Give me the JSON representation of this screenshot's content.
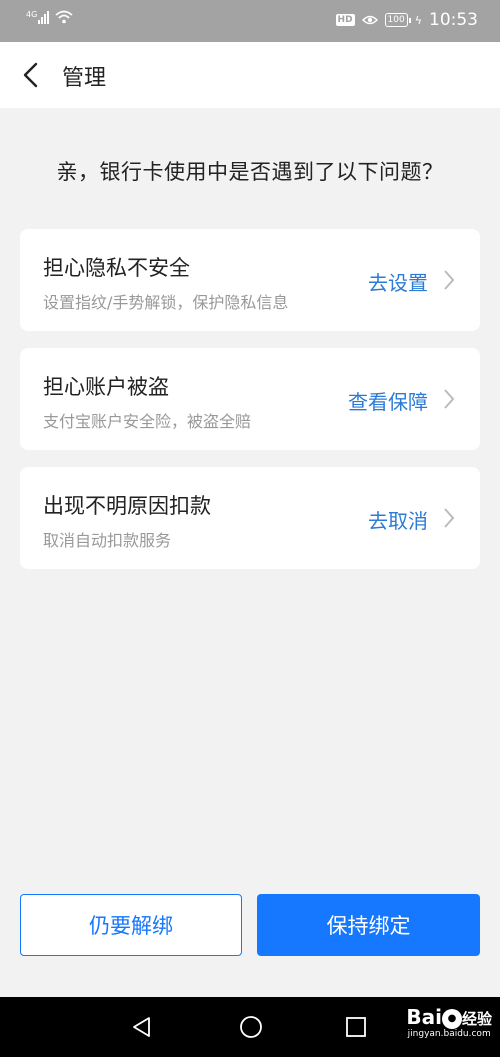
{
  "status_bar": {
    "signal_label": "4G",
    "hd_badge": "HD",
    "battery": "100",
    "time": "10:53"
  },
  "nav": {
    "title": "管理"
  },
  "question": "亲，银行卡使用中是否遇到了以下问题？",
  "cards": [
    {
      "title": "担心隐私不安全",
      "subtitle": "设置指纹/手势解锁，保护隐私信息",
      "action": "去设置"
    },
    {
      "title": "担心账户被盗",
      "subtitle": "支付宝账户安全险，被盗全赔",
      "action": "查看保障"
    },
    {
      "title": "出现不明原因扣款",
      "subtitle": "取消自动扣款服务",
      "action": "去取消"
    }
  ],
  "buttons": {
    "unbind": "仍要解绑",
    "keep": "保持绑定"
  },
  "watermark": {
    "logo_left": "Bai",
    "logo_right": "经验",
    "url": "jingyan.baidu.com"
  },
  "colors": {
    "accent": "#1677ff",
    "link": "#2c7bd6",
    "background": "#f2f2f2"
  }
}
